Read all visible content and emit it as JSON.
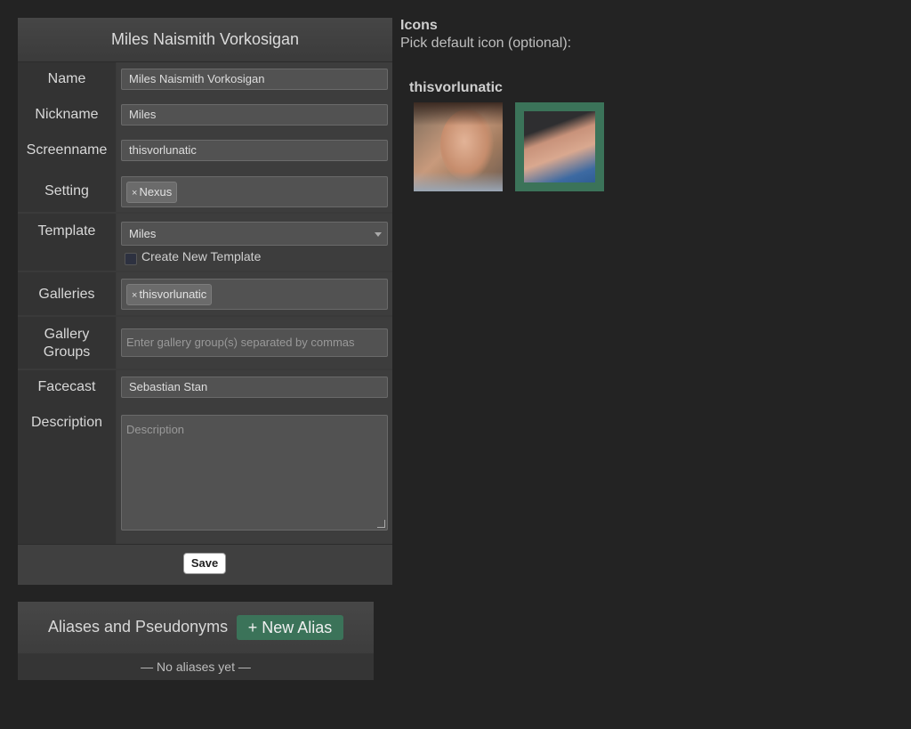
{
  "character_form": {
    "title": "Miles Naismith Vorkosigan",
    "fields": {
      "name": {
        "label": "Name",
        "value": "Miles Naismith Vorkosigan"
      },
      "nickname": {
        "label": "Nickname",
        "value": "Miles"
      },
      "screenname": {
        "label": "Screenname",
        "value": "thisvorlunatic"
      },
      "setting": {
        "label": "Setting",
        "tags": [
          "Nexus"
        ]
      },
      "template": {
        "label": "Template",
        "selected": "Miles",
        "create_new_label": "Create New Template"
      },
      "galleries": {
        "label": "Galleries",
        "tags": [
          "thisvorlunatic"
        ]
      },
      "gallery_groups": {
        "label_line1": "Gallery",
        "label_line2": "Groups",
        "placeholder": "Enter gallery group(s) separated by commas"
      },
      "facecast": {
        "label": "Facecast",
        "value": "Sebastian Stan"
      },
      "description": {
        "label": "Description",
        "placeholder": "Description"
      }
    },
    "save_label": "Save"
  },
  "aliases": {
    "title": "Aliases and Pseudonyms",
    "new_button": "+ New Alias",
    "empty_text": "— No aliases yet —"
  },
  "icons": {
    "title": "Icons",
    "subtitle": "Pick default icon (optional):",
    "gallery_name": "thisvorlunatic",
    "selected_index": 1,
    "accent_color": "#3b7359"
  },
  "tag_remove_glyph": "×"
}
